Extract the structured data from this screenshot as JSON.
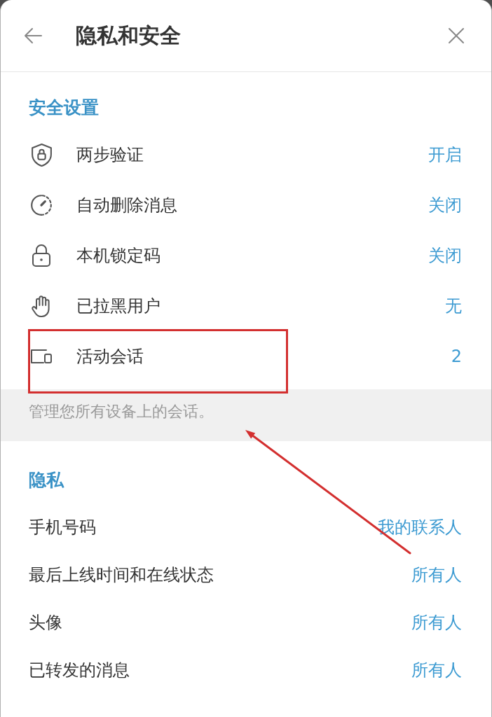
{
  "header": {
    "title": "隐私和安全"
  },
  "security": {
    "heading": "安全设置",
    "items": [
      {
        "label": "两步验证",
        "value": "开启"
      },
      {
        "label": "自动删除消息",
        "value": "关闭"
      },
      {
        "label": "本机锁定码",
        "value": "关闭"
      },
      {
        "label": "已拉黑用户",
        "value": "无"
      },
      {
        "label": "活动会话",
        "value": "2"
      }
    ]
  },
  "note": "管理您所有设备上的会话。",
  "privacy": {
    "heading": "隐私",
    "items": [
      {
        "label": "手机号码",
        "value": "我的联系人"
      },
      {
        "label": "最后上线时间和在线状态",
        "value": "所有人"
      },
      {
        "label": "头像",
        "value": "所有人"
      },
      {
        "label": "已转发的消息",
        "value": "所有人"
      }
    ]
  }
}
